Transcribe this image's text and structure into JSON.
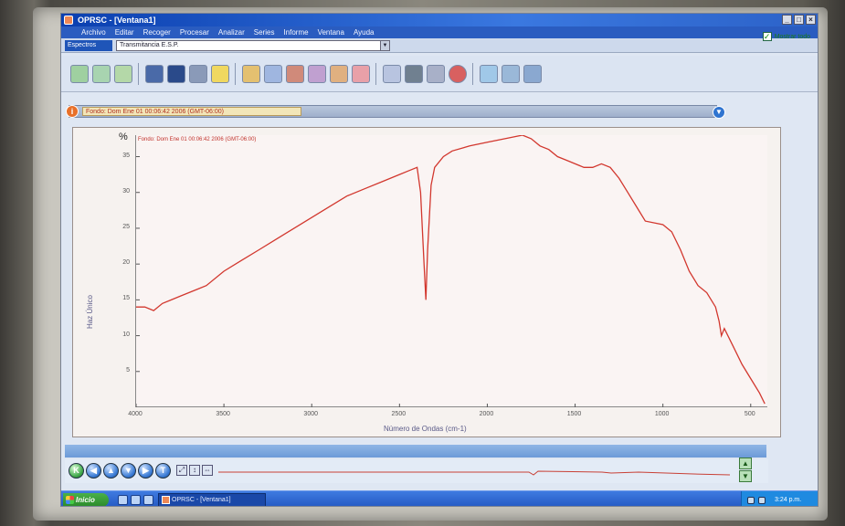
{
  "window": {
    "title": "OPRSC - [Ventana1]",
    "controls": [
      "_",
      "□",
      "×"
    ]
  },
  "menu": [
    "Archivo",
    "Editar",
    "Recoger",
    "Procesar",
    "Analizar",
    "Series",
    "Informe",
    "Ventana",
    "Ayuda"
  ],
  "selectbar": {
    "label": "Espectros",
    "value": "Transmitancia E.S.P.",
    "right_check_label": "Mostrar todo"
  },
  "info_bar": {
    "text": "Fondo: Dom Ene 01 00:06:42 2006 (GMT-06:00)"
  },
  "plot": {
    "title": "Fondo: Dom Ene 01 00:06:42 2006 (GMT-06:00)",
    "corner_label": "%",
    "colors": {
      "line": "#d2372e",
      "axis": "#555555"
    }
  },
  "chart_data": {
    "type": "line",
    "xlabel": "Número de Ondas (cm-1)",
    "ylabel": "Haz Único",
    "xlim": [
      4000,
      400
    ],
    "ylim": [
      0,
      38
    ],
    "xticks": [
      4000,
      3500,
      3000,
      2500,
      2000,
      1500,
      1000,
      500
    ],
    "yticks": [
      5,
      10,
      15,
      20,
      25,
      30,
      35
    ],
    "series": [
      {
        "x": [
          4000,
          3950,
          3900,
          3850,
          3800,
          3750,
          3700,
          3650,
          3600,
          3500,
          3400,
          3300,
          3200,
          3100,
          3000,
          2900,
          2800,
          2700,
          2600,
          2500,
          2450,
          2400,
          2380,
          2360,
          2350,
          2340,
          2320,
          2300,
          2250,
          2200,
          2100,
          2000,
          1900,
          1800,
          1750,
          1700,
          1650,
          1600,
          1550,
          1500,
          1450,
          1400,
          1350,
          1300,
          1250,
          1200,
          1150,
          1100,
          1000,
          950,
          900,
          850,
          800,
          750,
          700,
          680,
          667,
          650,
          600,
          550,
          500,
          450,
          420
        ],
        "y": [
          14,
          14,
          13.5,
          14.5,
          15,
          15.5,
          16,
          16.5,
          17,
          19,
          20.5,
          22,
          23.5,
          25,
          26.5,
          28,
          29.5,
          30.5,
          31.5,
          32.5,
          33,
          33.5,
          30,
          20,
          15,
          22,
          31,
          33.5,
          35,
          35.8,
          36.5,
          37,
          37.5,
          38,
          37.5,
          36.5,
          36,
          35,
          34.5,
          34,
          33.5,
          33.5,
          34,
          33.5,
          32,
          30,
          28,
          26,
          25.5,
          24.5,
          22,
          19,
          17,
          16,
          14,
          12,
          10,
          11,
          8.5,
          6,
          4,
          2,
          0.5
        ]
      }
    ]
  },
  "bottom": {
    "nav_buttons": [
      "K",
      "◀",
      "▲",
      "▼",
      "▶",
      "T"
    ]
  },
  "taskbar": {
    "start_label": "Inicio",
    "task_label": "OPRSC - [Ventana1]",
    "tray_time": "3:24 p.m."
  }
}
